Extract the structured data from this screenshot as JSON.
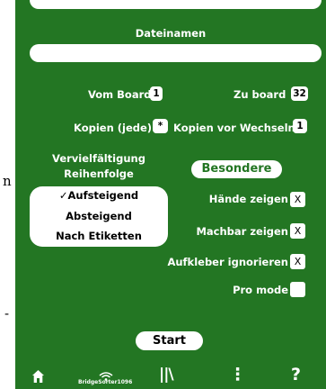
{
  "background_glyphs": {
    "a": "n",
    "b": "-"
  },
  "colors": {
    "panel": "#237623",
    "text": "#ffffff",
    "button_text": "#237623"
  },
  "filename": {
    "label": "Dateinamen",
    "value": ""
  },
  "board_range": {
    "from_label": "Vom Board",
    "from_value": "1",
    "to_label": "Zu board",
    "to_value": "32"
  },
  "copies": {
    "each_label": "Kopien (jede)",
    "each_value": "*",
    "before_change_label": "Kopien vor Wechseln",
    "before_change_value": "1"
  },
  "duplication": {
    "title_line1": "Vervielfältigung",
    "title_line2": "Reihenfolge",
    "options": [
      "✓Aufsteigend",
      "Absteigend",
      "Nach Etiketten"
    ],
    "selected_index": 0
  },
  "special_button": "Besondere",
  "toggles": [
    {
      "label": "Hände zeigen",
      "value": "X"
    },
    {
      "label": "Machbar zeigen",
      "value": "X"
    },
    {
      "label": "Aufkleber ignorieren",
      "value": "X"
    },
    {
      "label": "Pro mode",
      "value": ""
    }
  ],
  "start_button": "Start",
  "nav": {
    "home_icon": "home-icon",
    "device_label": "BridgeSorter1096",
    "library_glyph": "||\\",
    "more_glyph": "⋮",
    "help_glyph": "?"
  }
}
